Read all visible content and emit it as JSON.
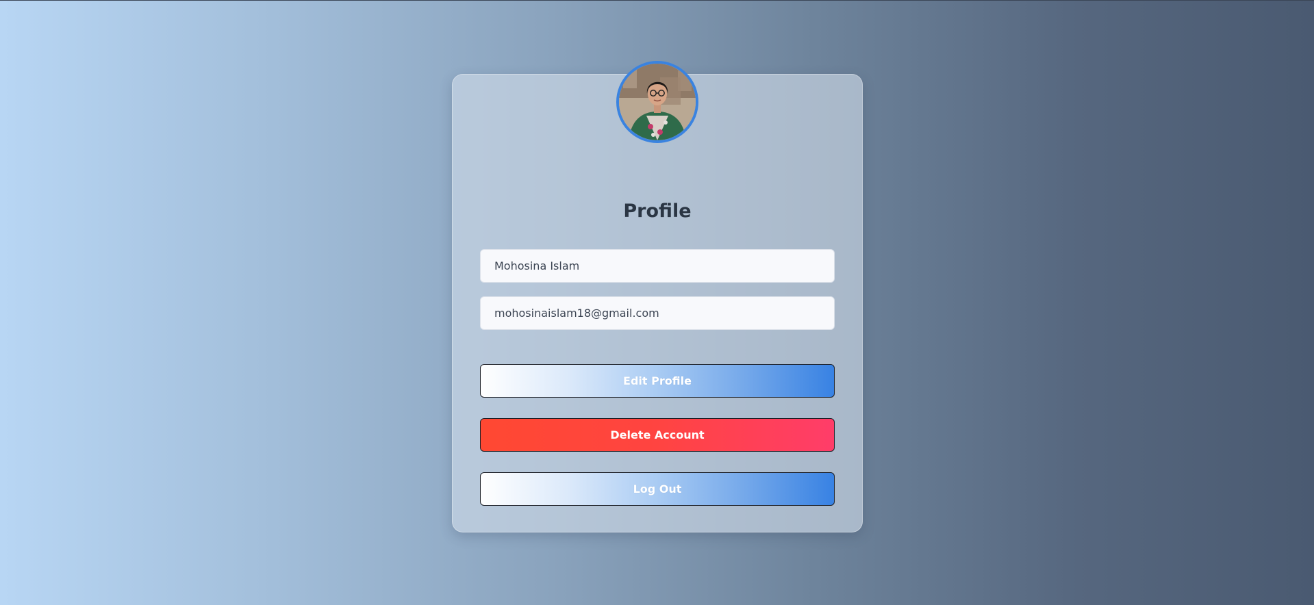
{
  "profile": {
    "title": "Profile",
    "name_value": "Mohosina Islam",
    "email_value": "mohosinaislam18@gmail.com",
    "avatar_icon": "user-photo"
  },
  "actions": {
    "edit_label": "Edit Profile",
    "delete_label": "Delete Account",
    "logout_label": "Log Out"
  },
  "colors": {
    "accent_blue": "#3882e3",
    "danger_start": "#ff4832",
    "danger_end": "#ff3d69",
    "title_text": "#2b3644"
  }
}
